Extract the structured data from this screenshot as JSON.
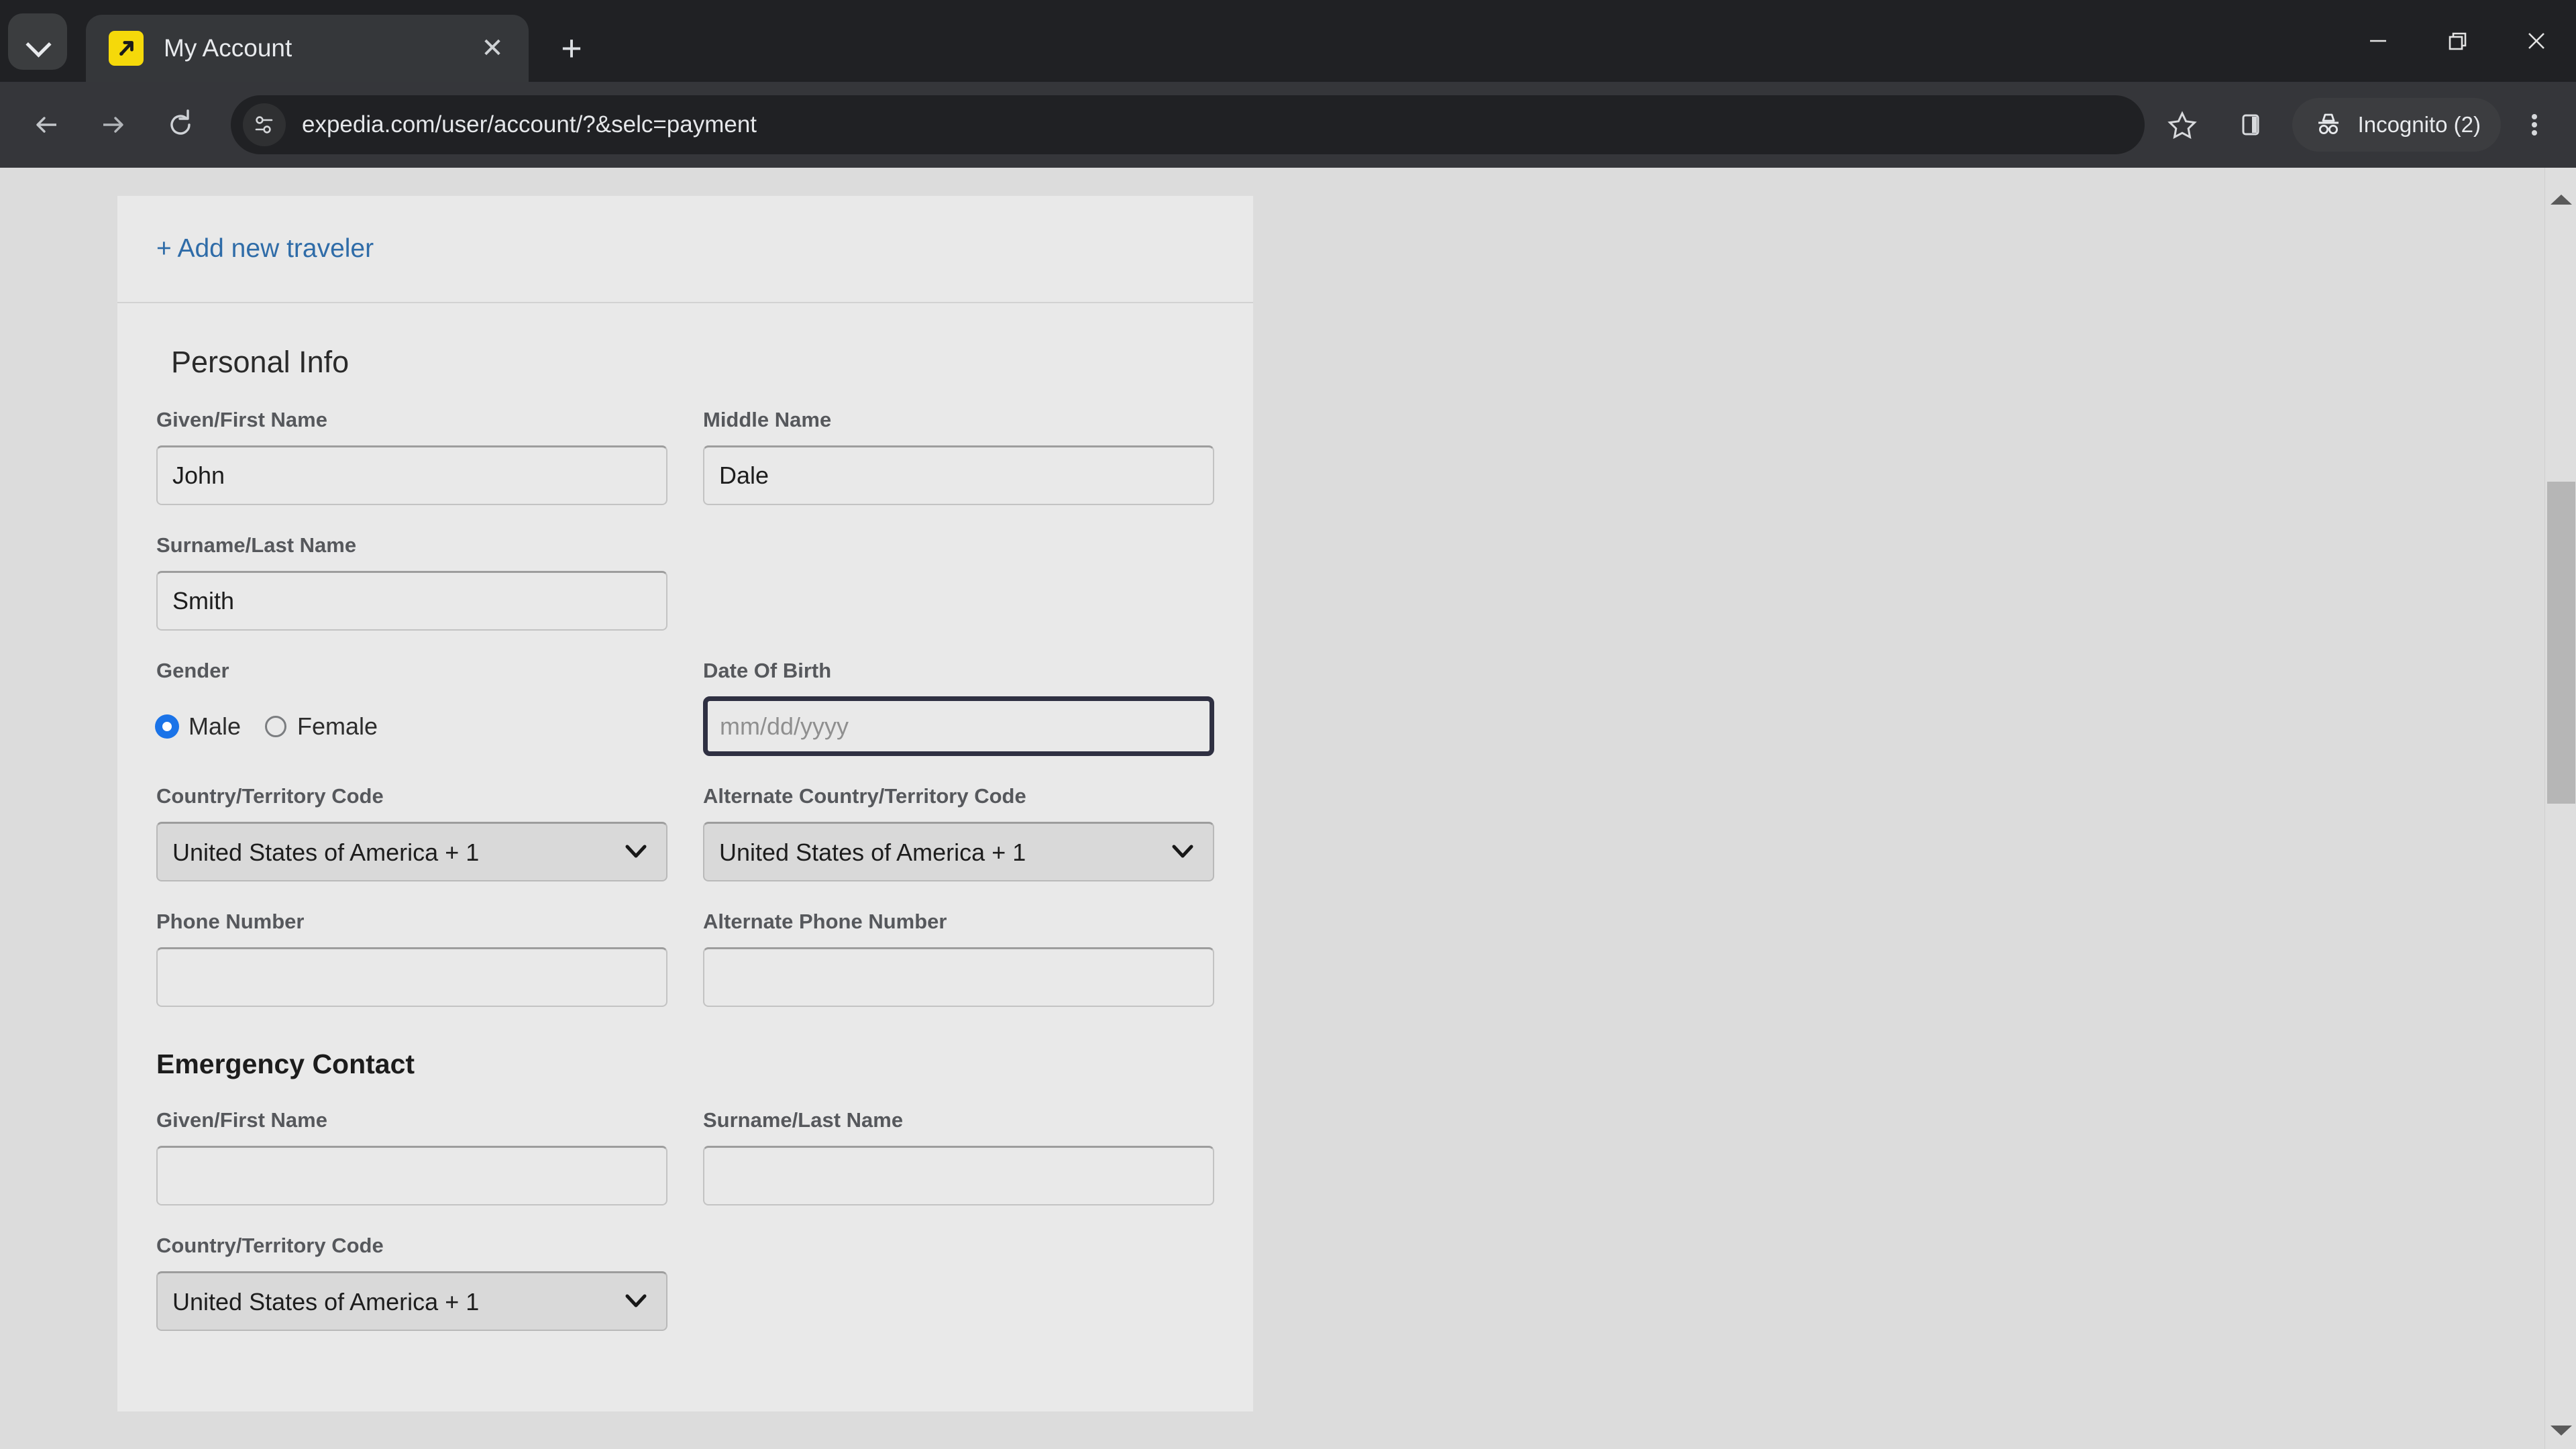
{
  "browser": {
    "tab": {
      "title": "My Account",
      "favicon_name": "expedia-favicon",
      "close_label": "✕"
    },
    "new_tab_label": "+",
    "tab_search_name": "tab-search-icon",
    "window": {
      "minimize": "—",
      "restore": "❐",
      "close": "✕"
    },
    "toolbar": {
      "back_name": "back-arrow-icon",
      "forward_name": "forward-arrow-icon",
      "reload_name": "reload-icon",
      "site_info_name": "site-settings-icon",
      "url": "expedia.com/user/account/?&selc=payment",
      "bookmark_name": "star-icon",
      "side_panel_name": "side-panel-icon",
      "incognito_label": "Incognito (2)",
      "incognito_icon_name": "incognito-hat-icon",
      "menu_name": "three-dot-menu-icon"
    }
  },
  "page": {
    "add_traveler_link": "+ Add new traveler",
    "personal_info": {
      "heading": "Personal Info",
      "first_name": {
        "label": "Given/First Name",
        "value": "John",
        "placeholder": ""
      },
      "middle_name": {
        "label": "Middle Name",
        "value": "Dale",
        "placeholder": ""
      },
      "last_name": {
        "label": "Surname/Last Name",
        "value": "Smith",
        "placeholder": ""
      },
      "gender": {
        "label": "Gender",
        "options": [
          "Male",
          "Female"
        ],
        "selected": "Male"
      },
      "dob": {
        "label": "Date Of Birth",
        "value": "",
        "placeholder": "mm/dd/yyyy",
        "focused": true
      },
      "country_code": {
        "label": "Country/Territory Code",
        "value": "United States of America + 1"
      },
      "alt_country_code": {
        "label": "Alternate Country/Territory Code",
        "value": "United States of America + 1"
      },
      "phone": {
        "label": "Phone Number",
        "value": "",
        "placeholder": ""
      },
      "alt_phone": {
        "label": "Alternate Phone Number",
        "value": "",
        "placeholder": ""
      }
    },
    "emergency_contact": {
      "heading": "Emergency Contact",
      "first_name": {
        "label": "Given/First Name",
        "value": "",
        "placeholder": ""
      },
      "last_name": {
        "label": "Surname/Last Name",
        "value": "",
        "placeholder": ""
      },
      "country_code": {
        "label": "Country/Territory Code",
        "value": "United States of America + 1"
      }
    }
  },
  "colors": {
    "chrome_bg": "#202124",
    "toolbar_bg": "#35363a",
    "omnibox_bg": "#202124",
    "page_bg": "#dcdcdc",
    "card_bg": "#e9e9e9",
    "link": "#2f6ca8",
    "radio_accent": "#1a73e8",
    "focus_border": "#2f3042",
    "favicon": "#f5d90a"
  }
}
